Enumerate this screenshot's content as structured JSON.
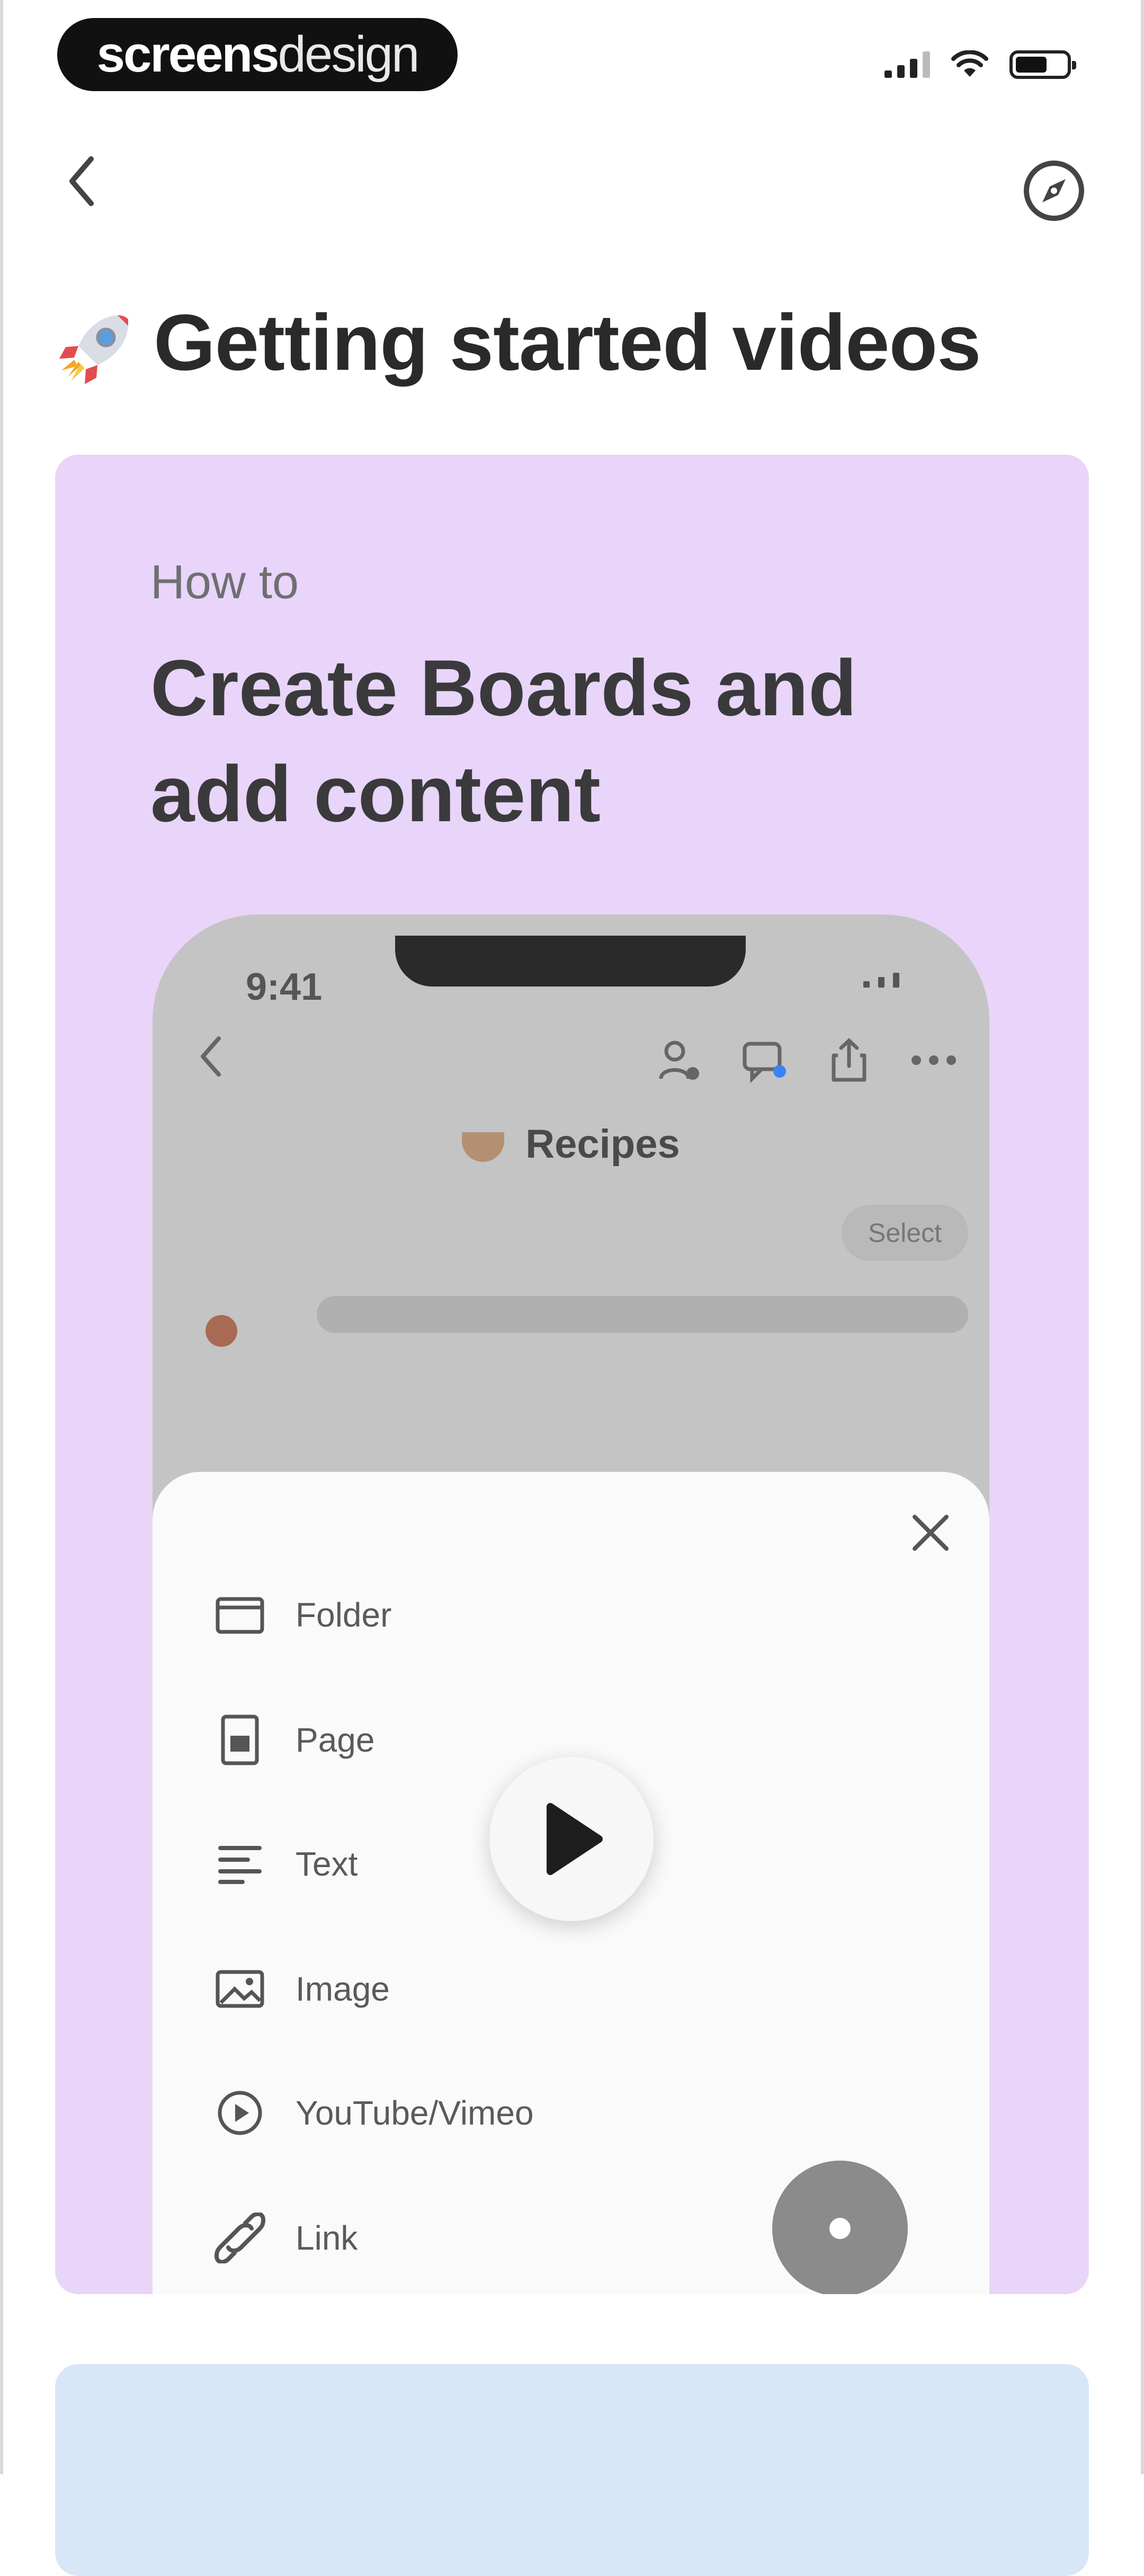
{
  "status_bar": {
    "brand_bold": "screens",
    "brand_light": "design"
  },
  "page": {
    "title": "Getting started videos",
    "title_icon": "rocket-icon"
  },
  "video_card": {
    "kicker": "How to",
    "heading": "Create Boards and add content",
    "background": "#e8d5f9",
    "preview": {
      "time": "9:41",
      "board_title": "Recipes",
      "select_label": "Select",
      "menu_items": [
        {
          "label": "Folder",
          "icon": "folder-icon"
        },
        {
          "label": "Page",
          "icon": "page-icon"
        },
        {
          "label": "Text",
          "icon": "text-icon"
        },
        {
          "label": "Image",
          "icon": "image-icon"
        },
        {
          "label": "YouTube/Vimeo",
          "icon": "play-circle-icon"
        },
        {
          "label": "Link",
          "icon": "link-icon"
        }
      ]
    }
  },
  "colors": {
    "next_card": "#d8e7f7",
    "accent_dark": "#111111"
  }
}
